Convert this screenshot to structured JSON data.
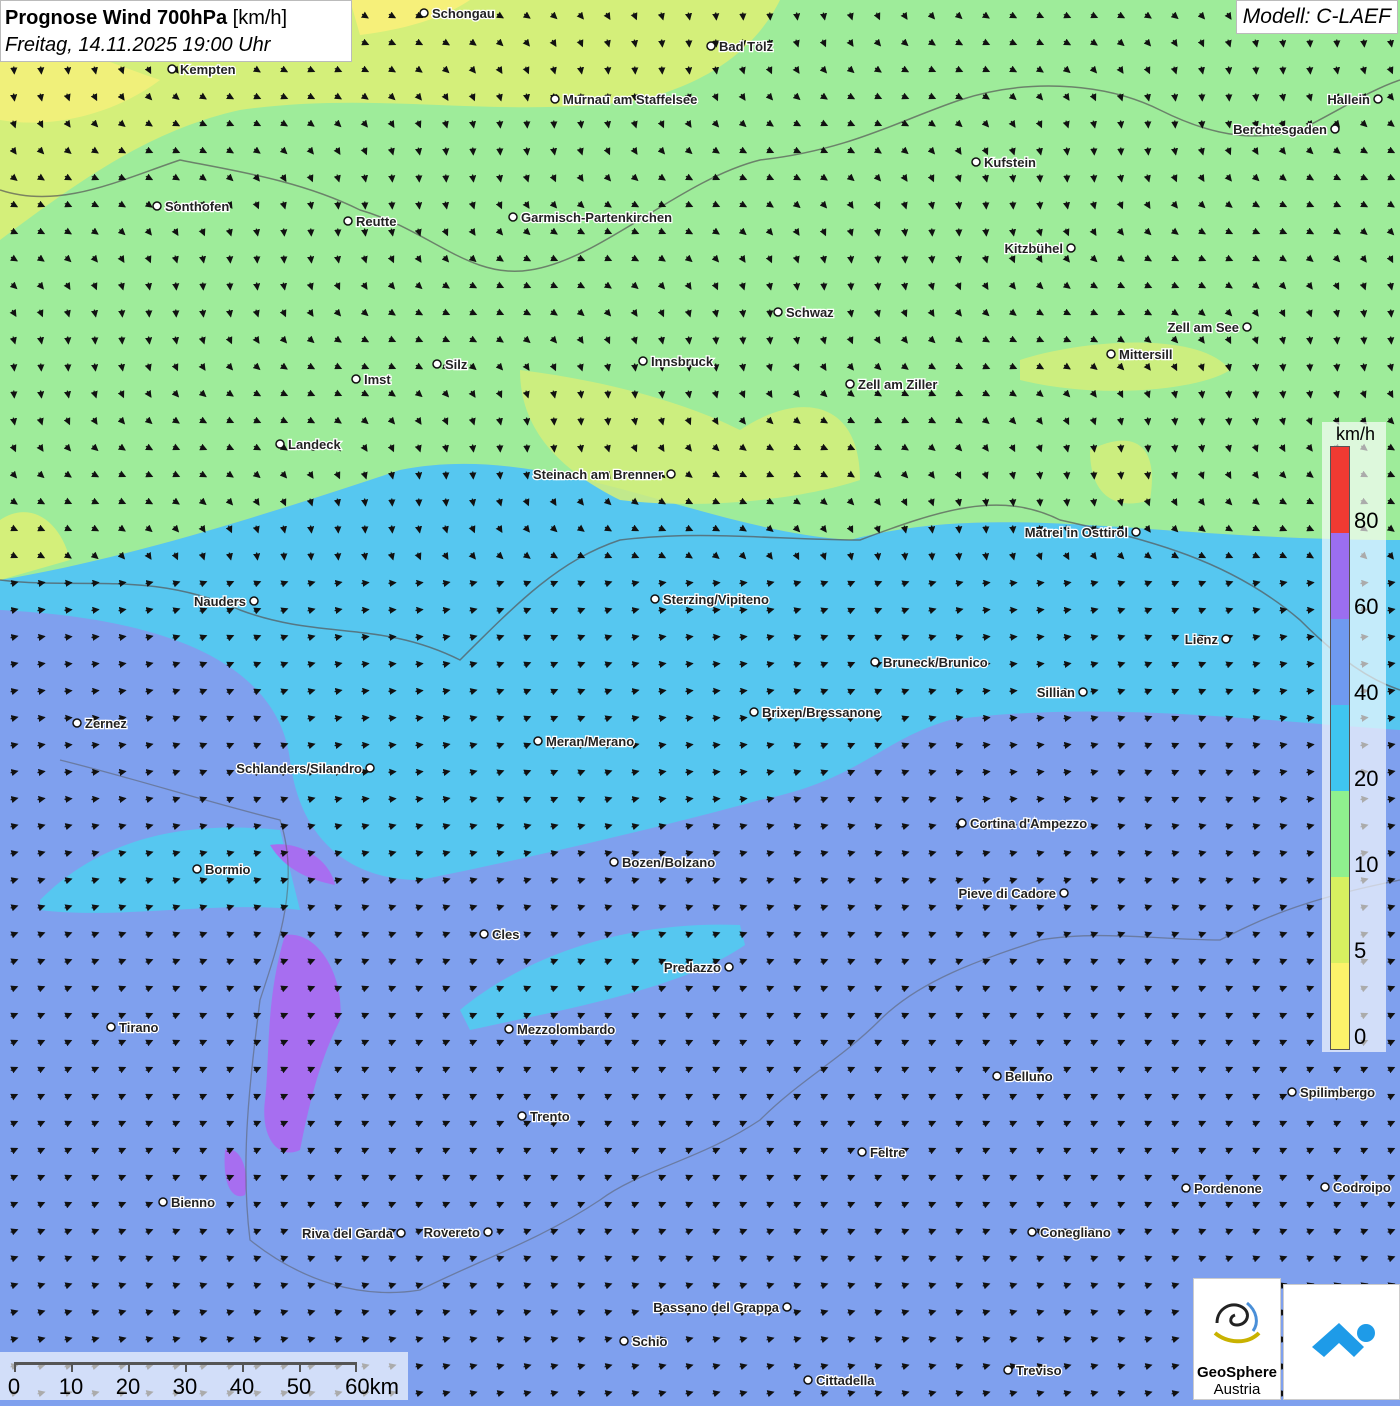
{
  "header": {
    "title_bold": "Prognose Wind 700hPa",
    "title_unit": "[km/h]",
    "subtitle": "Freitag, 14.11.2025 19:00 Uhr"
  },
  "model": "Modell: C-LAEF",
  "legend": {
    "unit": "km/h",
    "labels": [
      "80",
      "60",
      "40",
      "20",
      "10",
      "5",
      "0"
    ],
    "colors": [
      "#f03a32",
      "#9b6ef0",
      "#6f9af0",
      "#3fc5f0",
      "#8ff08e",
      "#d8f060",
      "#fcf36a"
    ]
  },
  "scale": {
    "labels": [
      "0",
      "10",
      "20",
      "30",
      "40",
      "50",
      "60km"
    ]
  },
  "logo": {
    "name": "GeoSphere",
    "sub": "Austria"
  },
  "cities": [
    {
      "name": "Schongau"
    },
    {
      "name": "Bad Tölz"
    },
    {
      "name": "Kempten"
    },
    {
      "name": "Murnau am Staffelsee"
    },
    {
      "name": "Hallein"
    },
    {
      "name": "Berchtesgaden"
    },
    {
      "name": "Kufstein"
    },
    {
      "name": "Sonthofen"
    },
    {
      "name": "Reutte"
    },
    {
      "name": "Garmisch-Partenkirchen"
    },
    {
      "name": "Kitzbühel"
    },
    {
      "name": "Schwaz"
    },
    {
      "name": "Zell am See"
    },
    {
      "name": "Innsbruck"
    },
    {
      "name": "Mittersill"
    },
    {
      "name": "Silz"
    },
    {
      "name": "Imst"
    },
    {
      "name": "Zell am Ziller"
    },
    {
      "name": "Landeck"
    },
    {
      "name": "Steinach am Brenner"
    },
    {
      "name": "Matrei in Osttirol"
    },
    {
      "name": "Nauders"
    },
    {
      "name": "Sterzing/Vipiteno"
    },
    {
      "name": "Lienz"
    },
    {
      "name": "Bruneck/Brunico"
    },
    {
      "name": "Sillian"
    },
    {
      "name": "Zernez"
    },
    {
      "name": "Brixen/Bressanone"
    },
    {
      "name": "Meran/Merano"
    },
    {
      "name": "Schlanders/Silandro"
    },
    {
      "name": "Cortina d'Ampezzo"
    },
    {
      "name": "Bozen/Bolzano"
    },
    {
      "name": "Bormio"
    },
    {
      "name": "Pieve di Cadore"
    },
    {
      "name": "Cles"
    },
    {
      "name": "Predazzo"
    },
    {
      "name": "Tirano"
    },
    {
      "name": "Mezzolombardo"
    },
    {
      "name": "Belluno"
    },
    {
      "name": "Spilimbergo"
    },
    {
      "name": "Trento"
    },
    {
      "name": "Feltre"
    },
    {
      "name": "Pordenone"
    },
    {
      "name": "Codroipo"
    },
    {
      "name": "Bienno"
    },
    {
      "name": "Riva del Garda"
    },
    {
      "name": "Rovereto"
    },
    {
      "name": "Conegliano"
    },
    {
      "name": "Bassano del Grappa"
    },
    {
      "name": "Schio"
    },
    {
      "name": "Treviso"
    },
    {
      "name": "Cittadella"
    }
  ]
}
